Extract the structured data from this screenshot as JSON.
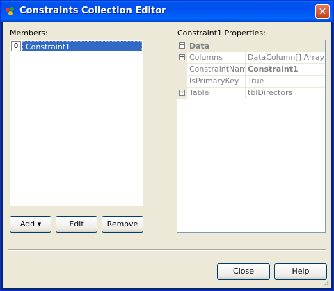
{
  "window": {
    "title": "Constraints Collection Editor",
    "close_glyph": "✕"
  },
  "members": {
    "label": "Members:",
    "items": [
      {
        "index": "0",
        "name": "Constraint1"
      }
    ]
  },
  "buttons": {
    "add": "Add ▾",
    "edit": "Edit",
    "remove": "Remove",
    "close": "Close",
    "help": "Help"
  },
  "properties": {
    "label": "Constraint1 Properties:",
    "category": "Data",
    "category_expander": "−",
    "rows": [
      {
        "name": "Columns",
        "value": "DataColumn[] Array",
        "expander": "+"
      },
      {
        "name": "ConstraintName",
        "value": "Constraint1",
        "expander": ""
      },
      {
        "name": "IsPrimaryKey",
        "value": "True",
        "expander": ""
      },
      {
        "name": "Table",
        "value": "tblDirectors",
        "expander": "+"
      }
    ]
  },
  "colors": {
    "titlebar": "#0053ee",
    "selection": "#316ac5",
    "dialog_bg": "#ece9d8"
  }
}
